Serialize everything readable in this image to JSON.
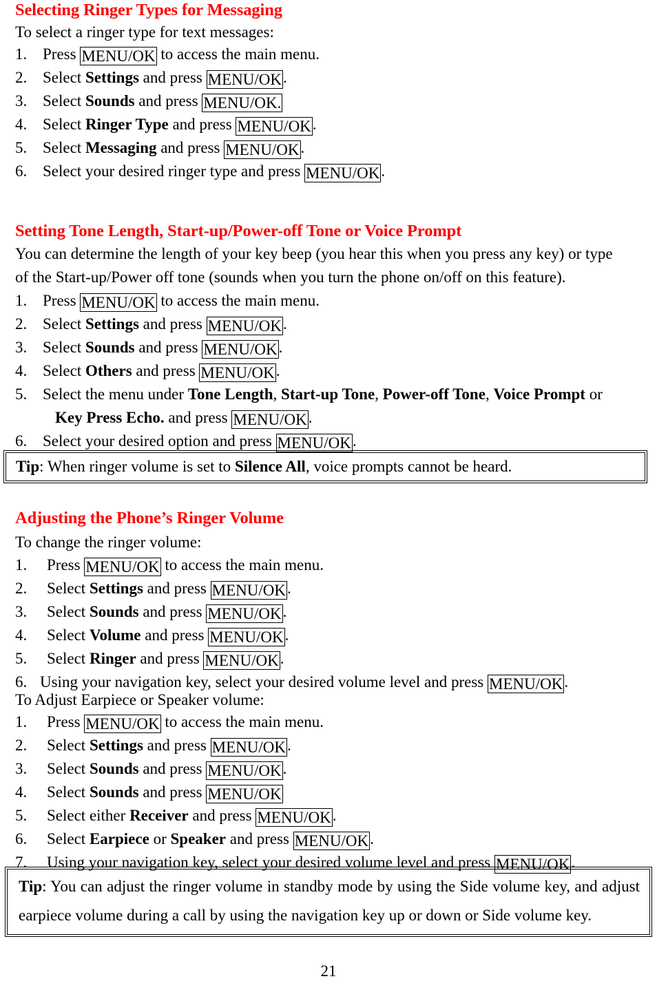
{
  "document": {
    "page_number": "21",
    "heading_color": "#ff0000",
    "key_label": "MENU/OK"
  },
  "sections": [
    {
      "heading": "Selecting Ringer Types for Messaging",
      "intro": "To select a ringer type for text messages:",
      "steps": [
        {
          "num": "1.",
          "pre": "Press ",
          "key": "MENU/OK",
          "post": " to access the main menu."
        },
        {
          "num": "2.",
          "pre": "Select ",
          "term": "Settings",
          "mid": " and press ",
          "key": "MENU/OK",
          "post": "."
        },
        {
          "num": "3.",
          "pre": "Select ",
          "term": "Sounds",
          "mid": " and press ",
          "key": "MENU/OK.",
          "post": ""
        },
        {
          "num": "4.",
          "pre": "Select ",
          "term": "Ringer Type",
          "mid": " and press ",
          "key": "MENU/OK",
          "post": "."
        },
        {
          "num": "5.",
          "pre": "Select ",
          "term": "Messaging",
          "mid": " and press ",
          "key": "MENU/OK",
          "post": "."
        },
        {
          "num": "6.",
          "pre": "Select your desired ringer type and press ",
          "key": "MENU/OK",
          "post": "."
        }
      ]
    },
    {
      "heading": "Setting Tone Length, Start-up/Power-off Tone or Voice Prompt",
      "intro_line1": "You can determine the length of your key beep (you hear this when you press any key) or type",
      "intro_line2": "of the Start-up/Power off tone (sounds when you turn the phone on/off on this feature).",
      "steps": [
        {
          "num": "1.",
          "pre": "Press ",
          "key": "MENU/OK",
          "post": " to access the main menu."
        },
        {
          "num": "2.",
          "pre": "Select ",
          "term": "Settings",
          "mid": " and press ",
          "key": "MENU/OK",
          "post": "."
        },
        {
          "num": "3.",
          "pre": "Select ",
          "term": "Sounds",
          "mid": " and press ",
          "key": "MENU/OK",
          "post": "."
        },
        {
          "num": "4.",
          "pre": "Select ",
          "term": "Others",
          "mid": " and press ",
          "key": "MENU/OK",
          "post": "."
        },
        {
          "num": "5.",
          "pre": "Select the menu under ",
          "terms": [
            "Tone Length",
            "Start-up Tone",
            "Power-off Tone",
            "Voice Prompt"
          ],
          "tail": " or",
          "cont_term": "Key Press Echo.",
          "cont_mid": " and press ",
          "key": "MENU/OK",
          "post": "."
        },
        {
          "num": "6.",
          "pre": "Select your desired option and press ",
          "key": "MENU/OK",
          "post": "."
        }
      ],
      "tip": {
        "label": "Tip",
        "pre": ": When ringer volume is set to ",
        "term": "Silence All",
        "post": ", voice prompts cannot be heard."
      }
    },
    {
      "heading": "Adjusting the Phone’s Ringer Volume",
      "intro": "To change the ringer volume:",
      "steps": [
        {
          "num": "1.",
          "pre": "Press ",
          "key": "MENU/OK",
          "post": " to access the main menu."
        },
        {
          "num": "2.",
          "pre": "Select ",
          "term": "Settings",
          "mid": " and press ",
          "key": "MENU/OK",
          "post": "."
        },
        {
          "num": "3.",
          "pre": "Select ",
          "term": "Sounds",
          "mid": " and press ",
          "key": "MENU/OK",
          "post": "."
        },
        {
          "num": "4.",
          "pre": "Select ",
          "term": "Volume",
          "mid": " and press ",
          "key": "MENU/OK",
          "post": "."
        },
        {
          "num": "5.",
          "pre": "Select ",
          "term": "Ringer",
          "mid": " and press ",
          "key": "MENU/OK",
          "post": "."
        },
        {
          "num": "6.",
          "pre": "Using your navigation key, select your desired volume level and press ",
          "key": "MENU/OK",
          "post": "."
        }
      ],
      "subintro": "To Adjust Earpiece or Speaker volume:",
      "steps2": [
        {
          "num": "1.",
          "pre": "Press ",
          "key": "MENU/OK",
          "post": " to access the main menu."
        },
        {
          "num": "2.",
          "pre": "Select ",
          "term": "Settings",
          "mid": " and press ",
          "key": "MENU/OK",
          "post": "."
        },
        {
          "num": "3.",
          "pre": "Select ",
          "term": "Sounds",
          "mid": " and press ",
          "key": "MENU/OK",
          "post": "."
        },
        {
          "num": "4.",
          "pre": "Select ",
          "term": "Sounds",
          "mid": " and press ",
          "key": "MENU/OK",
          "post": ""
        },
        {
          "num": "5.",
          "pre": "Select either ",
          "term": "Receiver",
          "mid": " and press ",
          "key": "MENU/OK",
          "post": "."
        },
        {
          "num": "6.",
          "pre": "Select ",
          "term": "Earpiece",
          "mid2": " or ",
          "term2": "Speaker",
          "mid": " and press ",
          "key": "MENU/OK",
          "post": "."
        },
        {
          "num": "7.",
          "pre": "Using your navigation key, select your desired volume level and press ",
          "key": "MENU/OK",
          "post": "."
        }
      ],
      "tip": {
        "label": "Tip",
        "text": ": You can adjust the ringer volume in standby mode by using the Side volume key, and adjust earpiece volume during a call by using the navigation key up or down or Side volume key."
      }
    }
  ]
}
